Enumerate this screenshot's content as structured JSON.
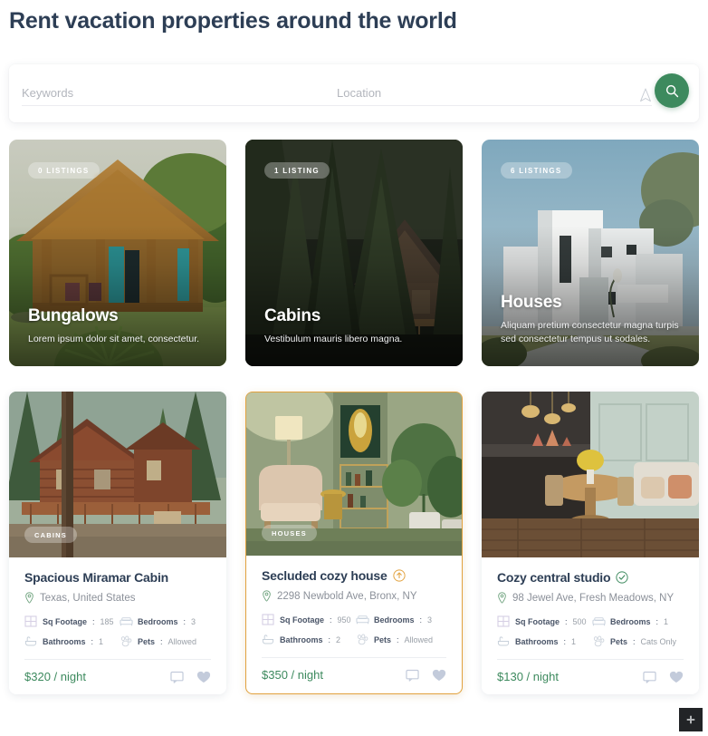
{
  "page": {
    "title": "Rent vacation properties around the world"
  },
  "search": {
    "keywords_placeholder": "Keywords",
    "keywords_value": "",
    "location_placeholder": "Location",
    "location_value": "",
    "locate_icon": "navigation-arrow-icon",
    "search_icon": "search-icon",
    "accent_color": "#3d8a5e"
  },
  "categories": [
    {
      "badge": "0 LISTINGS",
      "name": "Bungalows",
      "desc": "Lorem ipsum dolor sit amet, consectetur."
    },
    {
      "badge": "1 LISTING",
      "name": "Cabins",
      "desc": "Vestibulum mauris libero magna."
    },
    {
      "badge": "6 LISTINGS",
      "name": "Houses",
      "desc": "Aliquam pretium consectetur magna turpis sed consectetur tempus ut sodales."
    }
  ],
  "listings": [
    {
      "badge": "CABINS",
      "title": "Spacious Miramar Cabin",
      "title_icon": "",
      "address": "Texas, United States",
      "features": [
        {
          "label": "Sq Footage",
          "value": "185",
          "icon": "floorplan-icon"
        },
        {
          "label": "Bedrooms",
          "value": "3",
          "icon": "bed-icon"
        },
        {
          "label": "Bathrooms",
          "value": "1",
          "icon": "bathtub-icon"
        },
        {
          "label": "Pets",
          "value": "Allowed",
          "icon": "paw-icon"
        }
      ],
      "price": "$320 / night",
      "featured": false
    },
    {
      "badge": "HOUSES",
      "title": "Secluded cozy house",
      "title_icon": "featured-arrow-icon",
      "address": "2298 Newbold Ave, Bronx, NY",
      "features": [
        {
          "label": "Sq Footage",
          "value": "950",
          "icon": "floorplan-icon"
        },
        {
          "label": "Bedrooms",
          "value": "3",
          "icon": "bed-icon"
        },
        {
          "label": "Bathrooms",
          "value": "2",
          "icon": "bathtub-icon"
        },
        {
          "label": "Pets",
          "value": "Allowed",
          "icon": "paw-icon"
        }
      ],
      "price": "$350 / night",
      "featured": true
    },
    {
      "badge": "",
      "title": "Cozy central studio",
      "title_icon": "verified-check-icon",
      "address": "98 Jewel Ave, Fresh Meadows, NY",
      "features": [
        {
          "label": "Sq Footage",
          "value": "500",
          "icon": "floorplan-icon"
        },
        {
          "label": "Bedrooms",
          "value": "1",
          "icon": "bed-icon"
        },
        {
          "label": "Bathrooms",
          "value": "1",
          "icon": "bathtub-icon"
        },
        {
          "label": "Pets",
          "value": "Cats Only",
          "icon": "paw-icon"
        }
      ],
      "price": "$130 / night",
      "featured": false
    }
  ],
  "footer": {
    "fab_icon": "plus-icon"
  },
  "colors": {
    "title": "#2d3e55",
    "price_green": "#3d8a5e",
    "featured_border": "#e2a23e",
    "verified_green": "#3d8a5e"
  }
}
